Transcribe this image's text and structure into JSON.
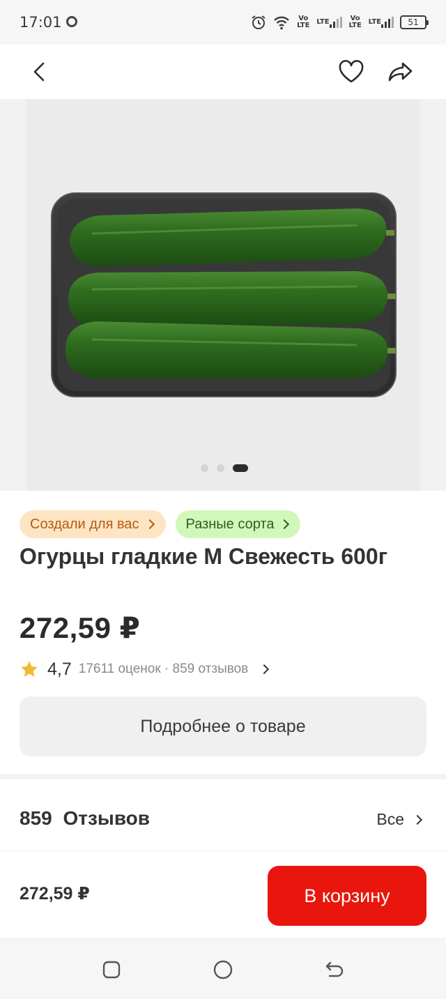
{
  "status_bar": {
    "time": "17:01",
    "network_1": "Vo LTE",
    "network_2": "LTE",
    "network_3": "Vo LTE",
    "network_4": "LTE",
    "battery": "51"
  },
  "gallery": {
    "image_alt": "Огурцы гладкие",
    "dots_total": 3,
    "dots_active": 3
  },
  "product": {
    "tags": [
      {
        "label": "Создали для вас"
      },
      {
        "label": "Разные сорта"
      }
    ],
    "title": "Огурцы гладкие М Свежесть 600г",
    "price": "272,59 ₽",
    "rating": "4,7",
    "rating_meta": "17611 оценок · 859 отзывов",
    "details_button": "Подробнее о товаре"
  },
  "reviews": {
    "title": "859  Отзывов",
    "all_link": "Все"
  },
  "buy_bar": {
    "price": "272,59 ₽",
    "cart_button": "В корзину"
  },
  "colors": {
    "accent_red": "#e8160c",
    "tag_orange_bg": "#fde5c4",
    "tag_green_bg": "#d2f7bb",
    "star": "#f5b82e"
  },
  "icons": [
    "alarm-icon",
    "wifi-icon",
    "back-icon",
    "heart-icon",
    "share-icon",
    "star-icon",
    "square-nav-icon",
    "circle-nav-icon",
    "back-nav-icon"
  ]
}
